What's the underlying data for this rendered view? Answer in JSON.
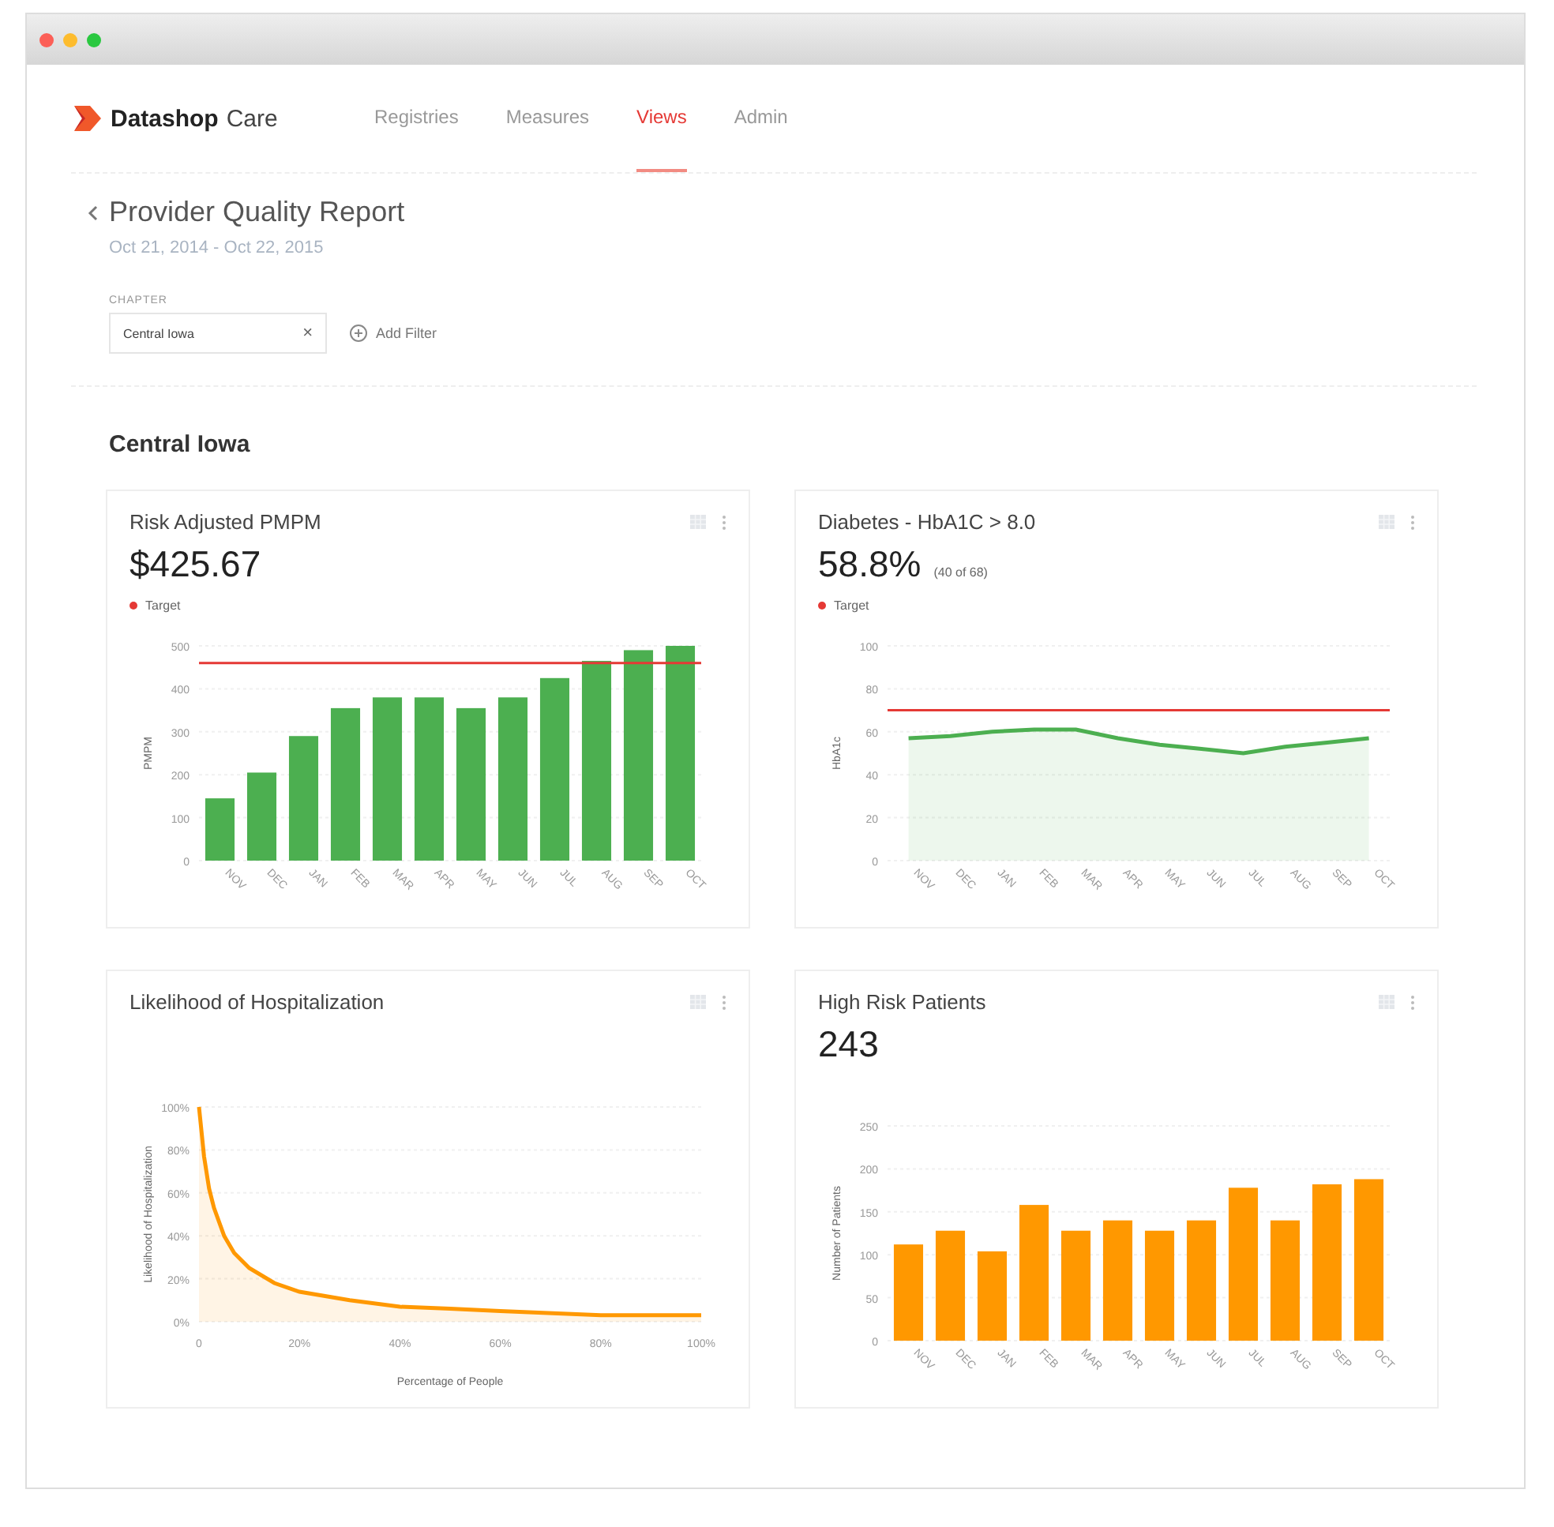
{
  "app": {
    "brand_bold": "Datashop",
    "brand_light": "Care"
  },
  "nav": [
    {
      "label": "Registries",
      "selected": false
    },
    {
      "label": "Measures",
      "selected": false
    },
    {
      "label": "Views",
      "selected": true
    },
    {
      "label": "Admin",
      "selected": false
    }
  ],
  "report": {
    "title": "Provider Quality Report",
    "date_range": "Oct 21, 2014 - Oct 22, 2015"
  },
  "filter": {
    "label": "CHAPTER",
    "value": "Central Iowa",
    "clear": "×",
    "add": "Add Filter"
  },
  "section_title": "Central Iowa",
  "cards": [
    {
      "title": "Risk Adjusted PMPM",
      "value": "$425.67",
      "chart_data": {
        "type": "bar",
        "ylabel": "PMPM",
        "categories": [
          "NOV",
          "DEC",
          "JAN",
          "FEB",
          "MAR",
          "APR",
          "MAY",
          "JUN",
          "JUL",
          "AUG",
          "SEP",
          "OCT"
        ],
        "series": [
          {
            "color": "#4caf50",
            "values": [
              145,
              205,
              290,
              355,
              380,
              380,
              355,
              380,
              425,
              465,
              490,
              500
            ]
          }
        ],
        "ylim": [
          0,
          500
        ],
        "yticks": [
          0,
          100,
          200,
          300,
          400,
          500
        ],
        "grid": true,
        "ref_lines": [
          {
            "axis": "y",
            "value": 460,
            "label": "Target",
            "color": "#e53935"
          }
        ]
      }
    },
    {
      "title": "Diabetes - HbA1C > 8.0",
      "value": "58.8%",
      "detail": "(40 of 68)",
      "chart_data": {
        "type": "area",
        "ylabel": "HbA1c",
        "categories": [
          "NOV",
          "DEC",
          "JAN",
          "FEB",
          "MAR",
          "APR",
          "MAY",
          "JUN",
          "JUL",
          "AUG",
          "SEP",
          "OCT"
        ],
        "series": [
          {
            "color": "#4caf50",
            "values": [
              57,
              58,
              60,
              61,
              61,
              57,
              54,
              52,
              50,
              53,
              55,
              57
            ]
          }
        ],
        "ylim": [
          0,
          100
        ],
        "yticks": [
          0,
          20,
          40,
          60,
          80,
          100
        ],
        "grid": true,
        "ref_lines": [
          {
            "axis": "y",
            "value": 70,
            "label": "Target",
            "color": "#e53935"
          }
        ]
      }
    },
    {
      "title": "Likelihood of Hospitalization",
      "chart_data": {
        "type": "area",
        "xlabel": "Percentage of People",
        "ylabel": "Likelihood of Hospitalization",
        "x": [
          0,
          1,
          2,
          3,
          5,
          7,
          10,
          15,
          20,
          30,
          40,
          50,
          60,
          80,
          100
        ],
        "grid": true,
        "series": [
          {
            "color": "#ff9800",
            "values": [
              100,
              77,
              62,
              53,
              40,
              32,
              25,
              18,
              14,
              10,
              7,
              6,
              5,
              3,
              3
            ]
          }
        ],
        "xlim": [
          0,
          100
        ],
        "ylim": [
          0,
          100
        ],
        "xticks": [
          {
            "value": 0,
            "label": "0"
          },
          {
            "value": 20,
            "label": "20%"
          },
          {
            "value": 40,
            "label": "40%"
          },
          {
            "value": 60,
            "label": "60%"
          },
          {
            "value": 80,
            "label": "80%"
          },
          {
            "value": 100,
            "label": "100%"
          }
        ],
        "yticks": [
          {
            "value": 0,
            "label": "0%"
          },
          {
            "value": 20,
            "label": "20%"
          },
          {
            "value": 40,
            "label": "40%"
          },
          {
            "value": 60,
            "label": "60%"
          },
          {
            "value": 80,
            "label": "80%"
          },
          {
            "value": 100,
            "label": "100%"
          }
        ]
      }
    },
    {
      "title": "High Risk Patients",
      "value": "243",
      "chart_data": {
        "type": "bar",
        "ylabel": "Number of Patients",
        "categories": [
          "NOV",
          "DEC",
          "JAN",
          "FEB",
          "MAR",
          "APR",
          "MAY",
          "JUN",
          "JUL",
          "AUG",
          "SEP",
          "OCT"
        ],
        "grid": true,
        "series": [
          {
            "color": "#ff9800",
            "values": [
              112,
              128,
              104,
              158,
              128,
              140,
              128,
              140,
              178,
              140,
              182,
              188
            ]
          }
        ],
        "ylim": [
          0,
          250
        ],
        "yticks": [
          0,
          50,
          100,
          150,
          200,
          250
        ]
      }
    }
  ]
}
